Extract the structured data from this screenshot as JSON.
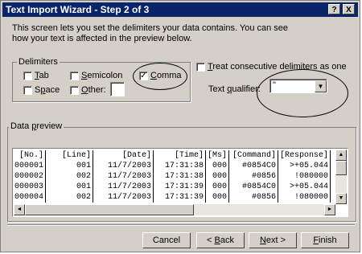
{
  "window": {
    "title": "Text Import Wizard - Step 2 of 3",
    "help_glyph": "?",
    "close_glyph": "X"
  },
  "intro": {
    "line1": "This screen lets you set the delimiters your data contains.  You can see",
    "line2": "how your text is affected in the preview below."
  },
  "delimiters": {
    "legend": "Delimiters",
    "tab": {
      "label": "Tab",
      "checked": false
    },
    "semicolon": {
      "label": "Semicolon",
      "checked": false
    },
    "comma": {
      "label": "Comma",
      "checked": true
    },
    "space": {
      "label": "Space",
      "checked": false
    },
    "other": {
      "label": "Other:",
      "checked": false,
      "value": ""
    },
    "check_glyph": "✓"
  },
  "consecutive": {
    "label": "Treat consecutive delimiters as one",
    "checked": false
  },
  "qualifier": {
    "label": "Text qualifier:",
    "value": "\"",
    "arrow": "▼"
  },
  "preview": {
    "legend": "Data preview",
    "columns": [
      "[No.]",
      "[Line]",
      "[Date]",
      "[Time]",
      "[Ms]",
      "[Command]",
      "[Response]"
    ],
    "rows": [
      [
        "000001",
        "001",
        "11/7/2003",
        "17:31:38",
        "000",
        "#0854C0",
        ">+05.044"
      ],
      [
        "000002",
        "002",
        "11/7/2003",
        "17:31:38",
        "000",
        "#0856",
        "!080000"
      ],
      [
        "000003",
        "001",
        "11/7/2003",
        "17:31:39",
        "000",
        "#0854C0",
        ">+05.044"
      ],
      [
        "000004",
        "002",
        "11/7/2003",
        "17:31:39",
        "000",
        "#0856",
        "!080000"
      ]
    ],
    "up": "▲",
    "down": "▼",
    "left": "◄",
    "right": "►"
  },
  "buttons": {
    "cancel": "Cancel",
    "back": "< Back",
    "next": "Next >",
    "finish": "Finish"
  },
  "colors": {
    "titlebar": "#0a246a",
    "face": "#d4d0c8"
  }
}
